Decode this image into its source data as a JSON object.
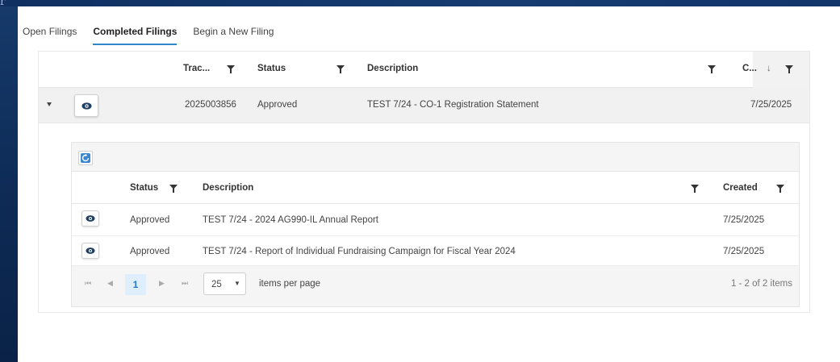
{
  "tabs": [
    {
      "label": "Open Filings"
    },
    {
      "label": "Completed Filings",
      "active": true
    },
    {
      "label": "Begin a New Filing"
    }
  ],
  "grid": {
    "columns": {
      "tracking": "Trac...",
      "status": "Status",
      "description": "Description",
      "created": "C...",
      "sort_indicator": "↓"
    },
    "row": {
      "tracking": "2025003856",
      "status": "Approved",
      "description": "TEST 7/24 - CO-1 Registration Statement",
      "created": "7/25/2025"
    }
  },
  "detail": {
    "columns": {
      "status": "Status",
      "description": "Description",
      "created": "Created"
    },
    "rows": [
      {
        "status": "Approved",
        "description": "TEST 7/24 - 2024 AG990-IL Annual Report",
        "created": "7/25/2025"
      },
      {
        "status": "Approved",
        "description": "TEST 7/24 - Report of Individual Fundraising Campaign for Fiscal Year 2024",
        "created": "7/25/2025"
      }
    ],
    "pager": {
      "current_page": "1",
      "page_size": "25",
      "items_per_page_label": "items per page",
      "info": "1 - 2 of 2 items"
    }
  },
  "colors": {
    "accent": "#2f86c8",
    "active_page_bg": "#dfeefc",
    "row_highlight": "#f1f1f1",
    "background": "#0d2b55"
  },
  "icons": [
    "eye-icon",
    "filter-icon",
    "refresh-icon",
    "expand-caret-icon",
    "first-page-icon",
    "prev-page-icon",
    "next-page-icon",
    "last-page-icon",
    "dropdown-caret-icon"
  ]
}
